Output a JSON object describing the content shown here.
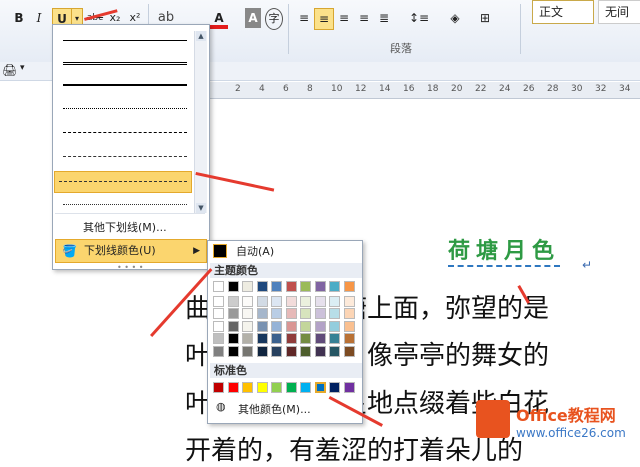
{
  "ribbon": {
    "font_buttons": [
      "B",
      "I",
      "U",
      "abc",
      "x₂",
      "x²"
    ],
    "para_group_label": "段落",
    "style_box_label": "正文",
    "style_box_label2": "无间"
  },
  "ruler": {
    "ticks": [
      "2",
      "4",
      "6",
      "8",
      "10",
      "12",
      "14",
      "16",
      "18",
      "20",
      "22",
      "24",
      "26",
      "28",
      "30",
      "32",
      "34"
    ]
  },
  "underline_menu": {
    "more_underlines": "其他下划线(M)...",
    "underline_color": "下划线颜色(U)"
  },
  "color_menu": {
    "auto": "自动(A)",
    "theme_colors": "主题颜色",
    "standard_colors": "标准色",
    "more_colors": "其他颜色(M)..."
  },
  "document": {
    "title": "荷塘月色",
    "lines": [
      "曲曲折折的荷塘上面，弥望的是",
      "叶子出水很高，像亭亭的舞女的",
      "叶子中间，零星地点缀着些白花",
      "开着的，有羞涩的打着朵儿的"
    ]
  },
  "watermark": {
    "brand": "Office教程网",
    "url": "www.office26.com"
  },
  "colors": {
    "theme_top": [
      "#ffffff",
      "#000000",
      "#eeece1",
      "#1f497d",
      "#4f81bd",
      "#c0504d",
      "#9bbb59",
      "#8064a2",
      "#4bacc6",
      "#f79646"
    ],
    "standard": [
      "#c00000",
      "#ff0000",
      "#ffc000",
      "#ffff00",
      "#92d050",
      "#00b050",
      "#00b0f0",
      "#0070c0",
      "#002060",
      "#7030a0"
    ]
  }
}
